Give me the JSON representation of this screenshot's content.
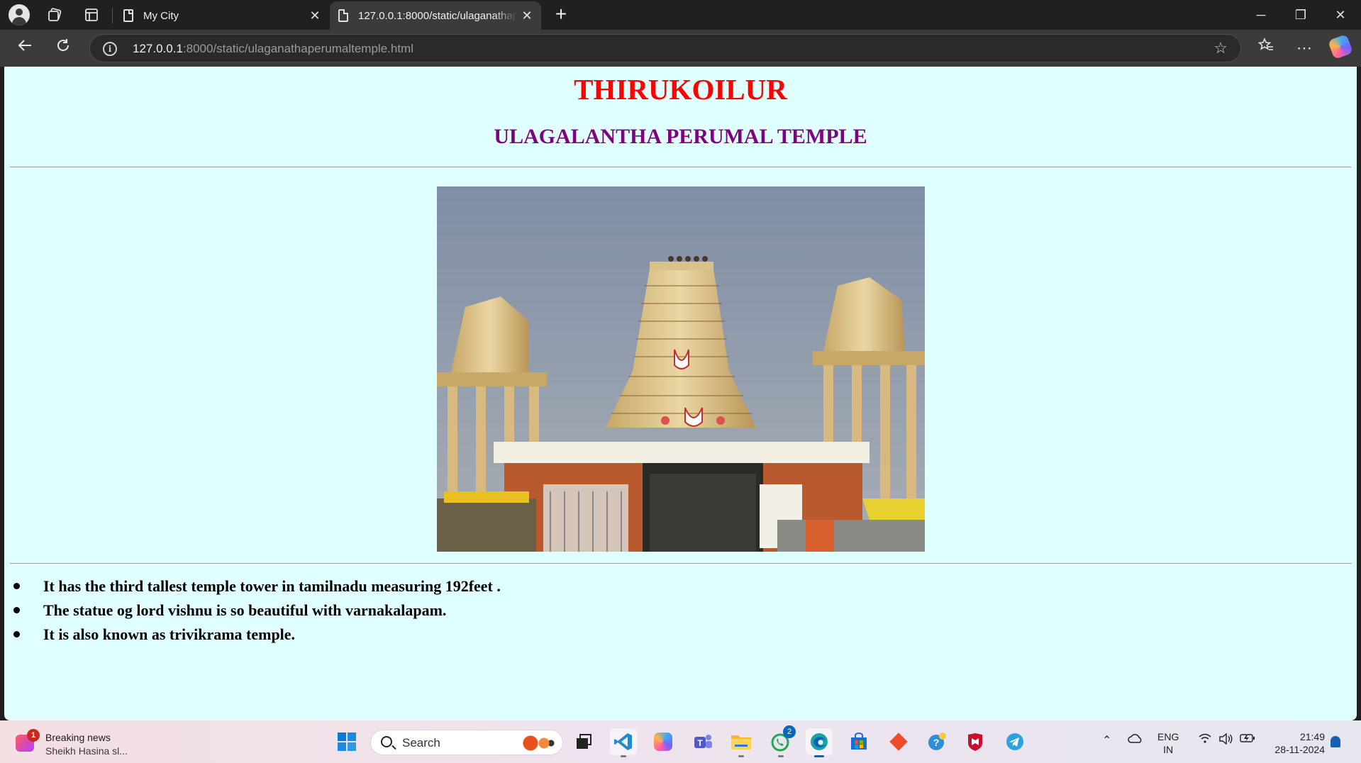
{
  "browser": {
    "tabs": [
      {
        "title": "My City",
        "active": false
      },
      {
        "title": "127.0.0.1:8000/static/ulaganathaperumaltemple.html",
        "active": true
      }
    ],
    "address": {
      "host": "127.0.0.1",
      "rest": ":8000/static/ulaganathaperumaltemple.html"
    }
  },
  "page": {
    "heading": "THIRUKOILUR",
    "subheading": "ULAGALANTHA PERUMAL TEMPLE",
    "facts": [
      "It has the third tallest temple tower in tamilnadu measuring 192feet .",
      "The statue og lord vishnu is so beautiful with varnakalapam.",
      "It is also known as trivikrama temple."
    ],
    "colors": {
      "background": "#e0ffff",
      "heading": "#ff0000",
      "subheading": "#800080"
    }
  },
  "taskbar": {
    "news": {
      "badge": "1",
      "title": "Breaking news",
      "subtitle": "Sheikh Hasina sl..."
    },
    "search_placeholder": "Search",
    "whatsapp_badge": "2",
    "lang_top": "ENG",
    "lang_bottom": "IN",
    "time": "21:49",
    "date": "28-11-2024"
  }
}
